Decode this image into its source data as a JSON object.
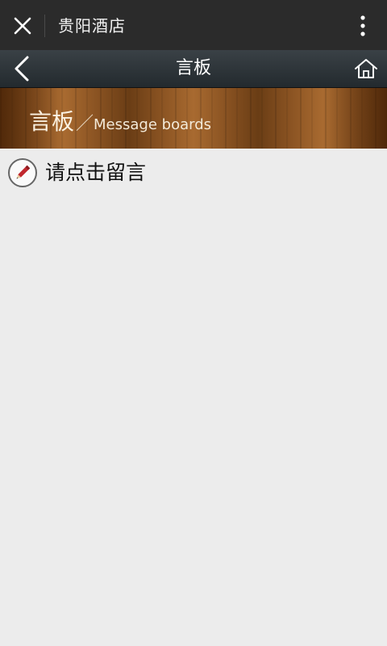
{
  "topbar": {
    "title": "贵阳酒店",
    "close_icon": "close-icon",
    "more_icon": "more-vertical-icon"
  },
  "navbar": {
    "title": "言板",
    "back_icon": "chevron-left-icon",
    "home_icon": "home-icon"
  },
  "banner": {
    "title_cn": "言板",
    "separator": "／",
    "title_en": "Message boards"
  },
  "content": {
    "leave_message_label": "请点击留言",
    "leave_message_icon": "pencil-icon"
  },
  "colors": {
    "topbar_bg": "#2b2b2b",
    "navbar_bg": "#2a3135",
    "page_bg": "#ececec",
    "pen_red": "#c0272d"
  }
}
